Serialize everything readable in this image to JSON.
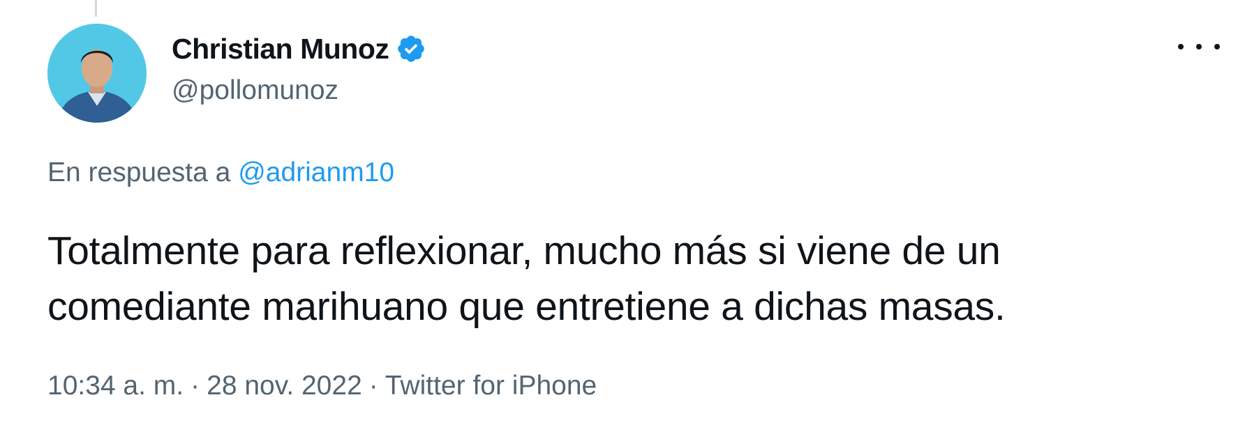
{
  "author": {
    "display_name": "Christian Munoz",
    "handle": "@pollomunoz",
    "verified": true
  },
  "reply": {
    "prefix": "En respuesta a",
    "to_handle": "@adrianm10"
  },
  "tweet": {
    "text_line_1": "Totalmente para reflexionar, mucho más si viene de un",
    "text_line_2": "comediante marihuano que entretiene a dichas masas."
  },
  "meta": {
    "time": "10:34 a. m.",
    "separator": "·",
    "date": "28 nov. 2022",
    "source": "Twitter for iPhone"
  },
  "icons": {
    "verified": "verified-badge-icon",
    "more": "more-options-icon"
  },
  "colors": {
    "accent": "#1d9bf0",
    "text": "#0f1419",
    "secondary_text": "#536471",
    "avatar_background": "#52c8e6"
  }
}
